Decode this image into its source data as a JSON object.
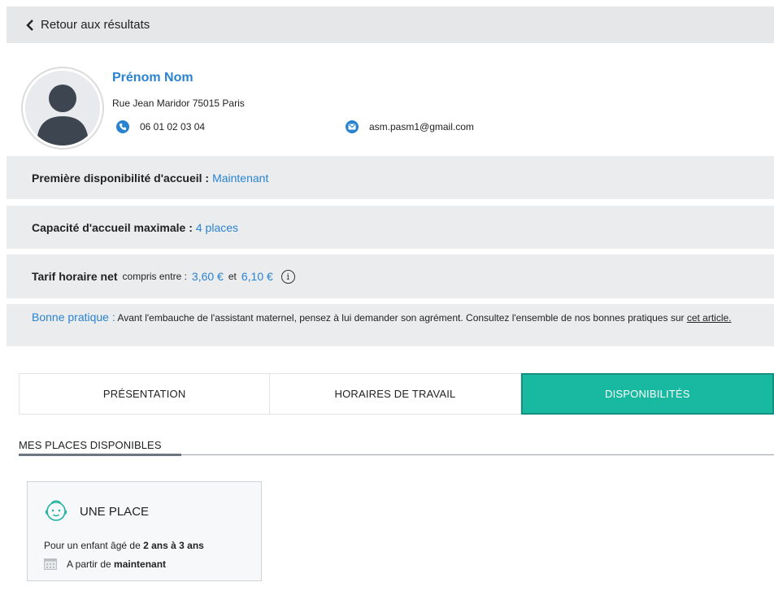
{
  "topbar": {
    "back_label": "Retour aux résultats"
  },
  "profile": {
    "name": "Prénom Nom",
    "address": "Rue Jean Maridor 75015 Paris",
    "phone": "06 01 02 03 04",
    "email": "asm.pasm1@gmail.com"
  },
  "availability": {
    "label": "Première disponibilité d'accueil :",
    "value": "Maintenant"
  },
  "capacity": {
    "label": "Capacité d'accueil maximale :",
    "value": "4 places"
  },
  "rate": {
    "label": "Tarif horaire net",
    "between": "compris entre :",
    "min": "3,60 €",
    "and": "et",
    "max": "6,10 €",
    "info_symbol": "i"
  },
  "good_practice": {
    "title": "Bonne pratique :",
    "text": "Avant l'embauche de l'assistant maternel, pensez à lui demander son agrément. Consultez l'ensemble de nos bonnes pratiques sur",
    "link": "cet article."
  },
  "tabs": [
    {
      "label": "PRÉSENTATION",
      "active": false
    },
    {
      "label": "HORAIRES DE TRAVAIL",
      "active": false
    },
    {
      "label": "DISPONIBILITÉS",
      "active": true
    }
  ],
  "section": {
    "title": "MES PLACES DISPONIBLES"
  },
  "place_card": {
    "title": "UNE PLACE",
    "age_prefix": "Pour un enfant âgé de",
    "age_value": "2 ans à 3 ans",
    "date_prefix": "A partir de",
    "date_value": "maintenant"
  },
  "colors": {
    "accent": "#2a83d1",
    "active_tab": "#18b9a0",
    "band": "#ebecee"
  },
  "icons": {
    "back": "chevron-left-icon",
    "phone": "phone-icon",
    "email": "mail-icon",
    "info": "info-icon",
    "baby": "baby-icon",
    "calendar": "calendar-icon"
  }
}
